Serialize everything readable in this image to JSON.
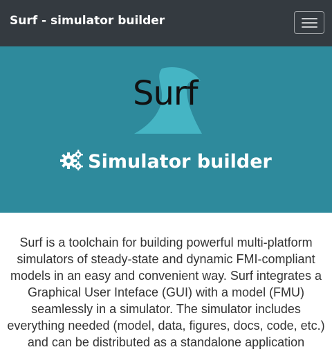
{
  "navbar": {
    "brand": "Surf - simulator builder",
    "toggler_icon": "hamburger-menu-icon"
  },
  "hero": {
    "logo_text": "Surf",
    "title_icon": "gears-icon",
    "title": "Simulator builder"
  },
  "main": {
    "description": "Surf is a toolchain for building powerful multi-platform simulators of steady-state and dynamic FMI-compliant models in an easy and convenient way. Surf integrates a Graphical User Inteface (GUI) with a model (FMU) seamlessly in a simulator. The simulator includes everything needed (model, data, figures, docs, code, etc.) and can be distributed as a standalone application"
  },
  "colors": {
    "navbar": "#343a40",
    "hero": "#2e8a9c",
    "wave": "#45b5c4",
    "text": "#333333"
  }
}
